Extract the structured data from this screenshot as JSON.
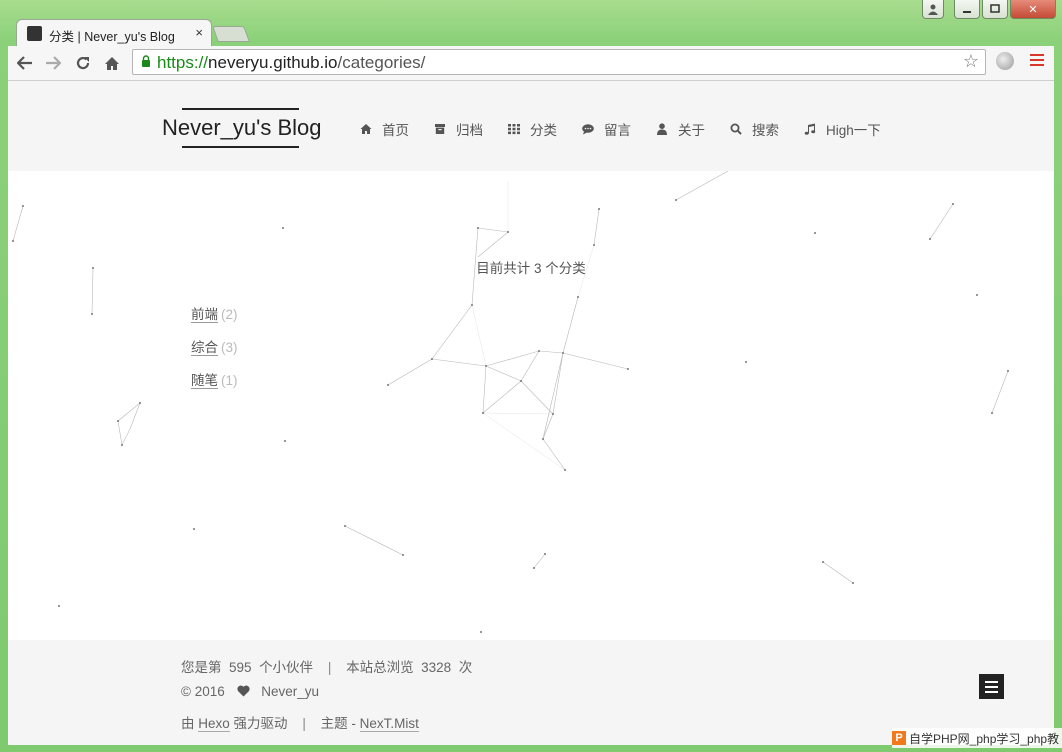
{
  "window": {
    "background_tabs": [
      "",
      "",
      "",
      ""
    ],
    "controls": {
      "minimize": "▭",
      "maximize": "□",
      "close": "✕"
    }
  },
  "tab": {
    "title": "分类 | Never_yu's Blog",
    "close_label": "×"
  },
  "address_bar": {
    "scheme": "https://",
    "host": "neveryu.github.io",
    "path": "/categories/"
  },
  "site": {
    "title": "Never_yu's Blog",
    "menu": [
      {
        "label": "首页",
        "icon": "home-icon"
      },
      {
        "label": "归档",
        "icon": "archive-icon"
      },
      {
        "label": "分类",
        "icon": "th-icon"
      },
      {
        "label": "留言",
        "icon": "comment-icon"
      },
      {
        "label": "关于",
        "icon": "user-icon"
      },
      {
        "label": "搜索",
        "icon": "search-icon"
      },
      {
        "label": "High一下",
        "icon": "music-icon"
      }
    ]
  },
  "main": {
    "category_count_text": "目前共计 3 个分类",
    "categories": [
      {
        "name": "前端",
        "count": "(2)"
      },
      {
        "name": "综合",
        "count": "(3)"
      },
      {
        "name": "随笔",
        "count": "(1)"
      }
    ]
  },
  "footer": {
    "visitors_prefix": "您是第",
    "visitors": "595",
    "visitors_suffix": "个小伙伴",
    "sep": "|",
    "views_prefix": "本站总浏览",
    "views": "3328",
    "views_suffix": "次",
    "copyright": "© 2016",
    "author": "Never_yu",
    "powered_prefix": "由",
    "powered_link": "Hexo",
    "powered_suffix": "强力驱动",
    "theme_prefix": "主题 -",
    "theme_link": "NexT.Mist"
  },
  "watermark": {
    "logo": "P",
    "text": "自学PHP网_php学习_php教"
  }
}
